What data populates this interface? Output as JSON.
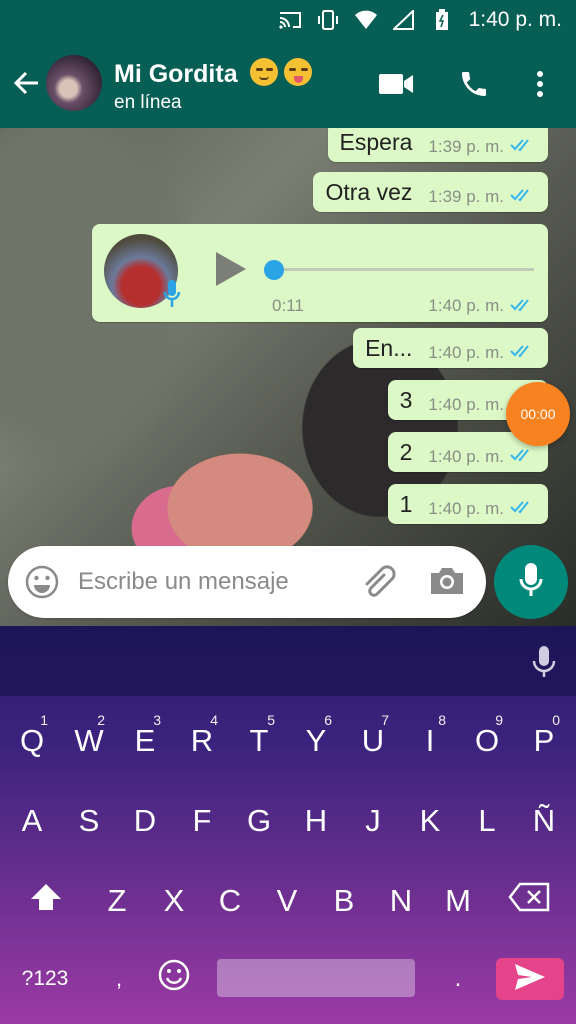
{
  "status_bar": {
    "time": "1:40 p. m."
  },
  "header": {
    "contact_name": "Mi Gordita",
    "contact_status": "en línea",
    "name_emojis": [
      "relieved-face",
      "squinting-tongue-face"
    ]
  },
  "messages": [
    {
      "text": "Espera",
      "time": "1:39 p. m.",
      "status": "read"
    },
    {
      "text": "Otra vez",
      "time": "1:39 p. m.",
      "status": "read"
    },
    {
      "text": "En...",
      "time": "1:40 p. m.",
      "status": "read"
    },
    {
      "text": "3",
      "time": "1:40 p. m.",
      "status": "read"
    },
    {
      "text": "2",
      "time": "1:40 p. m.",
      "status": "read"
    },
    {
      "text": "1",
      "time": "1:40 p. m.",
      "status": "read"
    }
  ],
  "voice_note": {
    "duration": "0:11",
    "time": "1:40 p. m.",
    "status": "read",
    "progress": 0.0
  },
  "recording_timer": "00:00",
  "composer": {
    "placeholder": "Escribe un mensaje"
  },
  "keyboard": {
    "row1": [
      {
        "label": "Q",
        "hint": "1"
      },
      {
        "label": "W",
        "hint": "2"
      },
      {
        "label": "E",
        "hint": "3"
      },
      {
        "label": "R",
        "hint": "4"
      },
      {
        "label": "T",
        "hint": "5"
      },
      {
        "label": "Y",
        "hint": "6"
      },
      {
        "label": "U",
        "hint": "7"
      },
      {
        "label": "I",
        "hint": "8"
      },
      {
        "label": "O",
        "hint": "9"
      },
      {
        "label": "P",
        "hint": "0"
      }
    ],
    "row2": [
      "A",
      "S",
      "D",
      "F",
      "G",
      "H",
      "J",
      "K",
      "L",
      "Ñ"
    ],
    "row3": [
      "Z",
      "X",
      "C",
      "V",
      "B",
      "N",
      "M"
    ],
    "symbols_key": "?123",
    "comma_key": ",",
    "period_key": "."
  },
  "colors": {
    "header": "#075e54",
    "outgoing_bubble": "#dcf8c6",
    "read_ticks": "#34b7f1",
    "mic_fab": "#00897b",
    "timer_fab": "#f8821f",
    "send_key": "#e5438a"
  }
}
